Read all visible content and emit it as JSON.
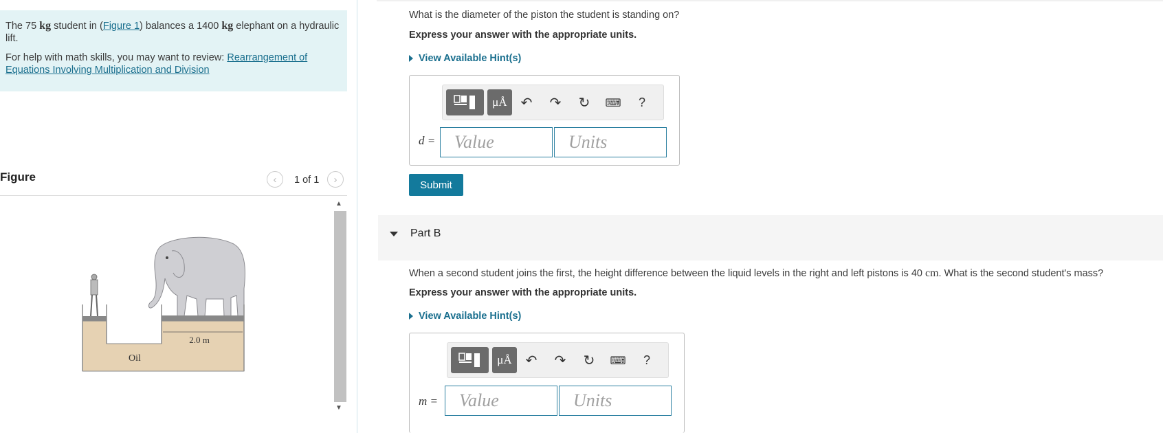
{
  "intro": {
    "line1_a": "The 75 ",
    "unit_kg": "kg",
    "line1_b": " student in (",
    "figure_link": "Figure 1",
    "line1_c": ") balances a 1400 ",
    "unit_kg2": "kg",
    "line1_d": " elephant on a hydraulic lift.",
    "help_text": "For help with math skills, you may want to review: ",
    "help_link": "Rearrangement of Equations Involving Multiplication and Division"
  },
  "figure": {
    "title": "Figure",
    "pager": "1 of 1",
    "prev": "‹",
    "next": "›",
    "dimension_label": "2.0 m",
    "fluid_label": "Oil"
  },
  "part_a": {
    "question": "What is the diameter of the piston the student is standing on?",
    "instruction": "Express your answer with the appropriate units.",
    "hint": "View Available Hint(s)",
    "variable": "d =",
    "value_placeholder": "Value",
    "units_placeholder": "Units",
    "submit": "Submit"
  },
  "part_b": {
    "title": "Part B",
    "question_a": "When a second student joins the first, the height difference between the liquid levels in the right and left pistons is 40 ",
    "unit_cm": "cm",
    "question_b": ". What is the second student's mass?",
    "instruction": "Express your answer with the appropriate units.",
    "hint": "View Available Hint(s)",
    "variable": "m =",
    "value_placeholder": "Value",
    "units_placeholder": "Units"
  },
  "toolbar": {
    "mu_label": "μÅ",
    "help": "?"
  }
}
